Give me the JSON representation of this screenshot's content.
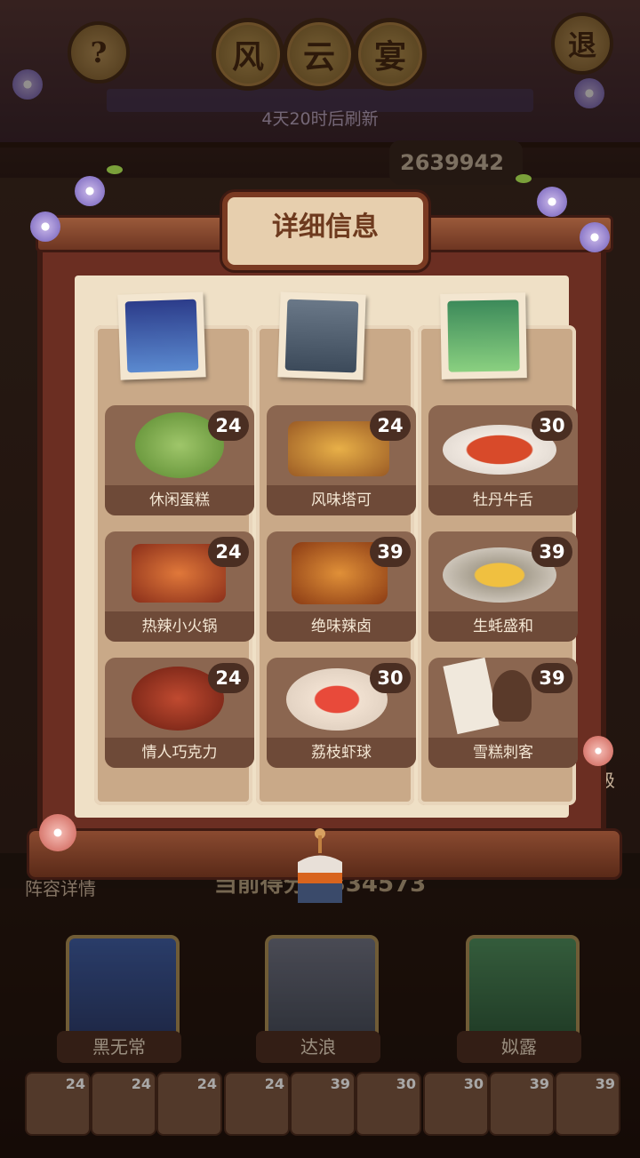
{
  "header": {
    "title_chars": [
      "风",
      "云",
      "宴"
    ],
    "help_label": "?",
    "exit_label": "退",
    "refresh_text": "4天20时后刷新",
    "score_partial": "2639942"
  },
  "panel": {
    "title": "详细信息",
    "characters": [
      {
        "name": "黑无常",
        "dishes": [
          {
            "name": "休闲蛋糕",
            "score": "24"
          },
          {
            "name": "热辣小火锅",
            "score": "24"
          },
          {
            "name": "情人巧克力",
            "score": "24"
          }
        ]
      },
      {
        "name": "达浪",
        "dishes": [
          {
            "name": "风味塔可",
            "score": "24"
          },
          {
            "name": "绝味辣卤",
            "score": "39"
          },
          {
            "name": "荔枝虾球",
            "score": "30"
          }
        ]
      },
      {
        "name": "姒露",
        "dishes": [
          {
            "name": "牡丹牛舌",
            "score": "30"
          },
          {
            "name": "生蚝盛和",
            "score": "39"
          },
          {
            "name": "雪糕刺客",
            "score": "39"
          }
        ]
      }
    ]
  },
  "bottom": {
    "lineup_label": "阵容详情",
    "current_score_text": "当前得分：334573",
    "side_text": "级",
    "heroes": [
      "黑无常",
      "达浪",
      "姒露"
    ],
    "mini_scores": [
      "24",
      "24",
      "24",
      "24",
      "39",
      "30",
      "30",
      "39",
      "39"
    ]
  },
  "colors": {
    "panel_wood": "#6b2e22",
    "panel_paper": "#efe0c6",
    "badge_bg": "#4a2e22",
    "column_bg": "#c9a988"
  }
}
